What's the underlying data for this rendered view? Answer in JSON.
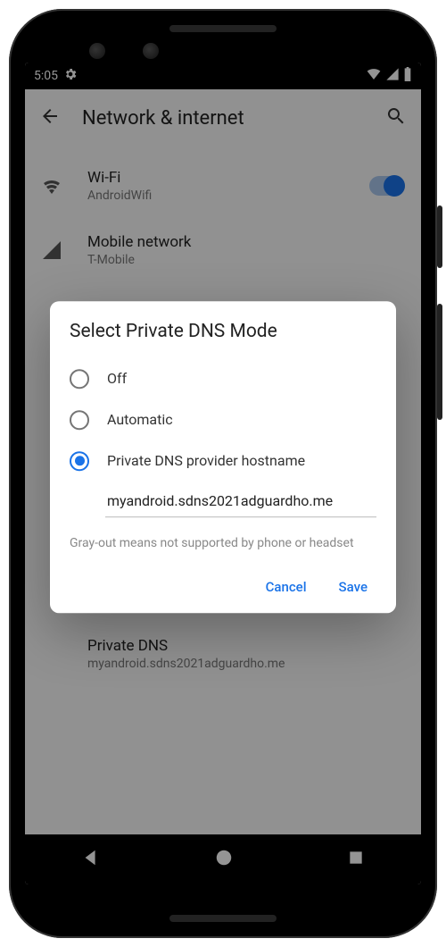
{
  "status_bar": {
    "time": "5:05"
  },
  "app_bar": {
    "title": "Network & internet"
  },
  "settings": {
    "wifi": {
      "label": "Wi-Fi",
      "value": "AndroidWifi"
    },
    "mobile": {
      "label": "Mobile network",
      "value": "T-Mobile"
    },
    "private_dns": {
      "label": "Private DNS",
      "value": "myandroid.sdns2021adguardho.me"
    }
  },
  "dialog": {
    "title": "Select Private DNS Mode",
    "options": {
      "off": "Off",
      "automatic": "Automatic",
      "hostname": "Private DNS provider hostname"
    },
    "hostname_value": "myandroid.sdns2021adguardho.me",
    "hint": "Gray-out means not supported by phone or headset",
    "cancel": "Cancel",
    "save": "Save"
  }
}
